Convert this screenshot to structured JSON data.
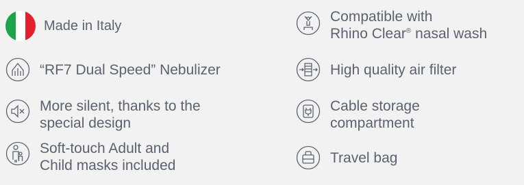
{
  "features_left": [
    {
      "icon": "italian-flag-icon",
      "lines": [
        "Made in Italy"
      ]
    },
    {
      "icon": "nebulizer-icon",
      "lines": [
        "“RF7 Dual Speed” Nebulizer"
      ]
    },
    {
      "icon": "silent-speaker-icon",
      "lines": [
        "More silent, thanks to the",
        "special design"
      ]
    },
    {
      "icon": "adult-child-icon",
      "lines": [
        "Soft-touch Adult and",
        "Child masks included"
      ]
    }
  ],
  "features_right": [
    {
      "icon": "nasal-wash-icon",
      "lines": [
        "Compatible with",
        "Rhino Clear",
        "®",
        " nasal wash"
      ]
    },
    {
      "icon": "air-filter-icon",
      "lines": [
        "High quality air filter"
      ]
    },
    {
      "icon": "cable-storage-icon",
      "lines": [
        "Cable storage",
        "compartment"
      ]
    },
    {
      "icon": "travel-bag-icon",
      "lines": [
        "Travel bag"
      ]
    }
  ],
  "colors": {
    "text": "#5a6270",
    "icon_stroke": "#5a6270",
    "flag_green": "#1ea44b",
    "flag_white": "#ffffff",
    "flag_red": "#e5202e",
    "background": "#f2f2f2"
  }
}
